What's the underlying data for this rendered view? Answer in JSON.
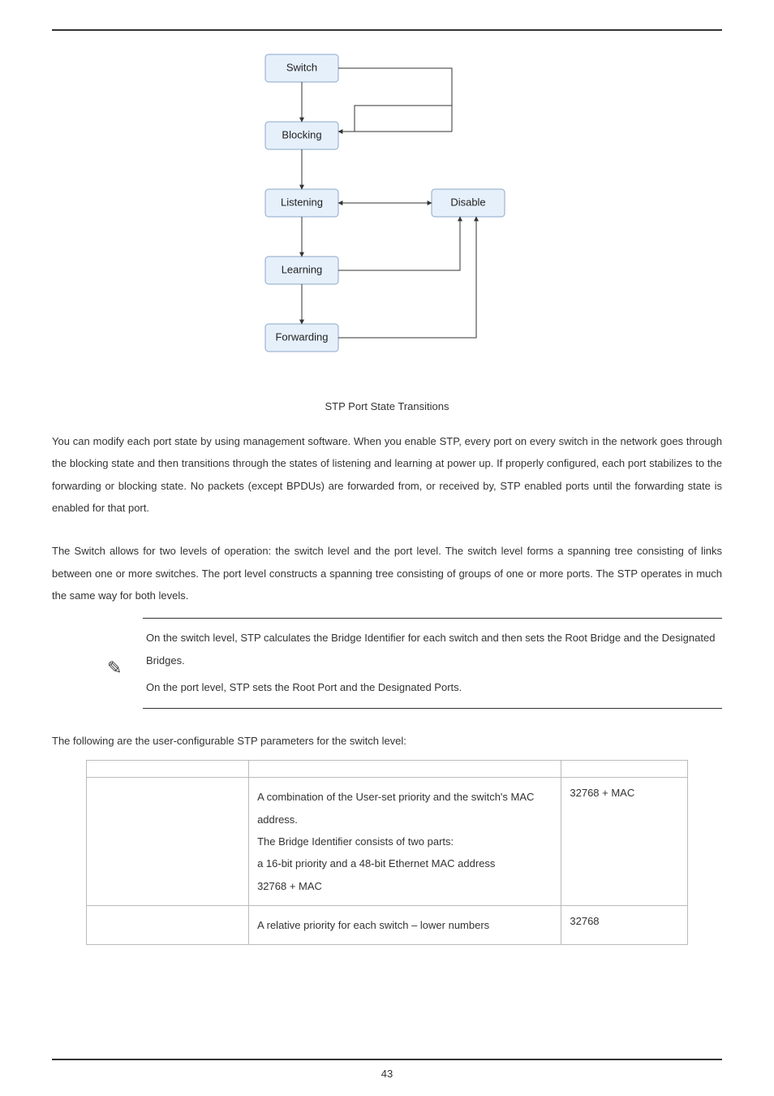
{
  "diagram": {
    "nodes": {
      "switch": "Switch",
      "blocking": "Blocking",
      "listening": "Listening",
      "learning": "Learning",
      "forwarding": "Forwarding",
      "disable": "Disable"
    },
    "caption": "STP Port State Transitions"
  },
  "paragraph1": "You can modify each port state by using management software. When you enable STP, every port on every switch in the network goes through the blocking state and then transitions through the states of listening and learning at power up. If properly configured, each port stabilizes to the forwarding or blocking state. No packets (except BPDUs) are forwarded from, or received by, STP enabled ports until the forwarding state is enabled for that port.",
  "paragraph2": "The Switch allows for two levels of operation: the switch level and the port level. The switch level forms a spanning tree consisting of links between one or more switches. The port level constructs a spanning tree consisting of groups of one or more ports. The STP operates in much the same way for both levels.",
  "note": {
    "line1": "On the switch level, STP calculates the Bridge Identifier for each switch and then sets the Root Bridge and the Designated Bridges.",
    "line2": "On the port level, STP sets the Root Port and the Designated Ports."
  },
  "table_intro": "The following are the user-configurable STP parameters for the switch level:",
  "table": {
    "headers": {
      "param": "",
      "desc": "",
      "def": ""
    },
    "rows": [
      {
        "param": "",
        "desc": "A combination of the User-set priority and the switch's MAC address.\nThe Bridge Identifier consists of two parts:\na 16-bit priority and a 48-bit Ethernet MAC address\n32768 + MAC",
        "def": "32768 + MAC"
      },
      {
        "param": "",
        "desc": "A relative priority for each switch – lower numbers",
        "def": "32768"
      }
    ]
  },
  "page_number": "43"
}
